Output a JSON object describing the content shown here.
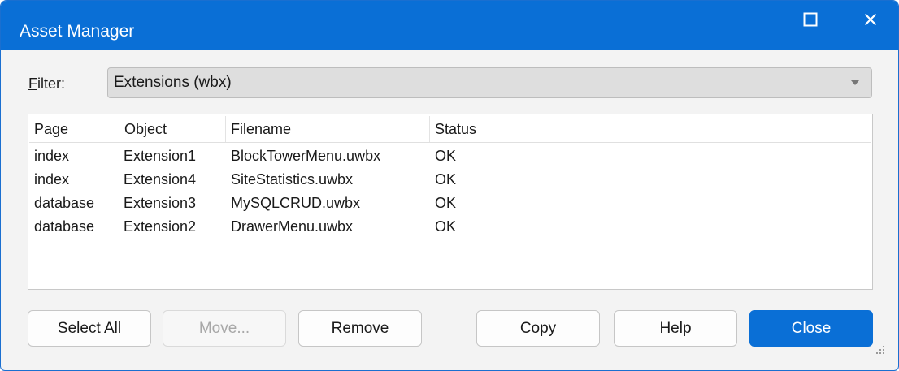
{
  "window": {
    "title": "Asset Manager",
    "accent_color": "#0a6fd6",
    "maximize_icon": "maximize-icon",
    "close_icon": "close-icon"
  },
  "filter": {
    "label_accel": "F",
    "label_rest": "ilter:",
    "selected": "Extensions (wbx)"
  },
  "table": {
    "columns": [
      "Page",
      "Object",
      "Filename",
      "Status"
    ],
    "rows": [
      {
        "page": "index",
        "object": "Extension1",
        "filename": "BlockTowerMenu.uwbx",
        "status": "OK"
      },
      {
        "page": "index",
        "object": "Extension4",
        "filename": "SiteStatistics.uwbx",
        "status": "OK"
      },
      {
        "page": "database",
        "object": "Extension3",
        "filename": "MySQLCRUD.uwbx",
        "status": "OK"
      },
      {
        "page": "database",
        "object": "Extension2",
        "filename": "DrawerMenu.uwbx",
        "status": "OK"
      }
    ]
  },
  "buttons": {
    "select_all": {
      "accel": "S",
      "rest": "elect All"
    },
    "move": {
      "before": "Mo",
      "accel": "v",
      "after": "e..."
    },
    "remove": {
      "accel": "R",
      "rest": "emove"
    },
    "copy": "Copy",
    "help": "Help",
    "close": {
      "accel": "C",
      "rest": "lose"
    }
  }
}
